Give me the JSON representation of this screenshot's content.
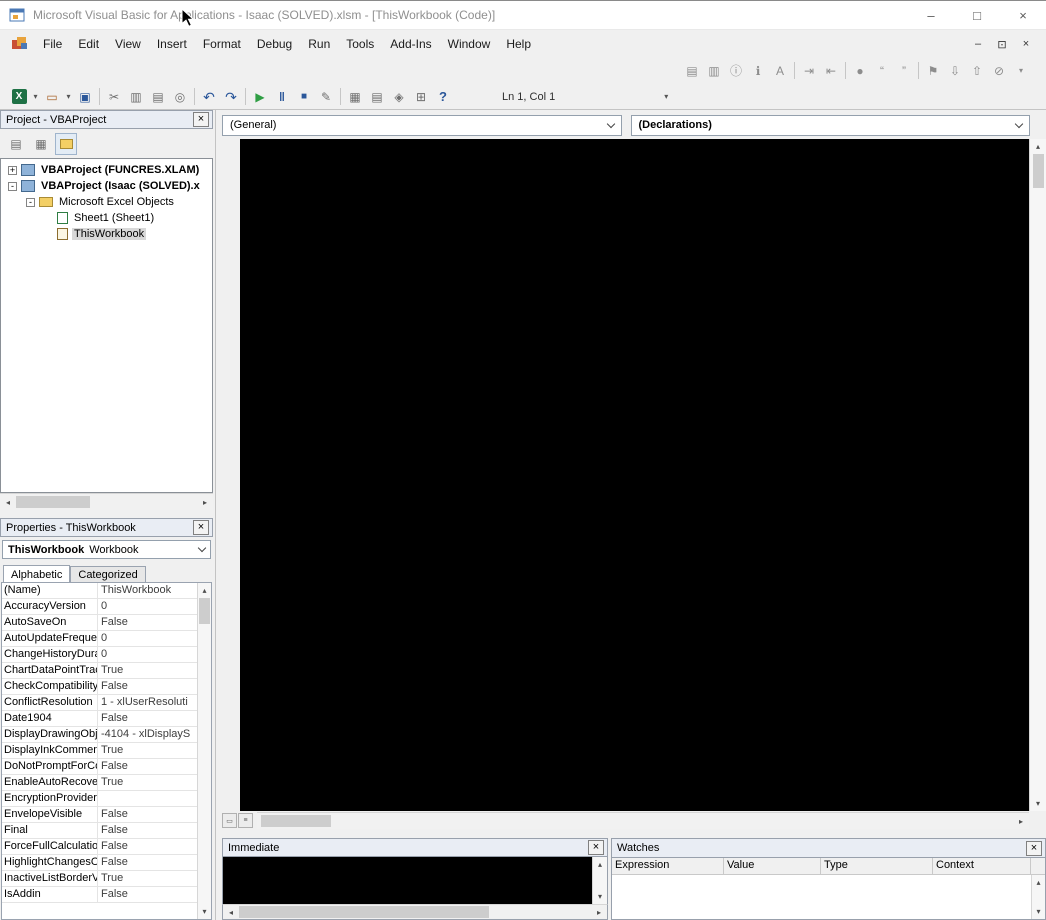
{
  "window": {
    "title": "Microsoft Visual Basic for Applications - Isaac (SOLVED).xlsm - [ThisWorkbook (Code)]",
    "controls": {
      "minimize": "–",
      "maximize": "□",
      "close": "×"
    },
    "mdi": {
      "minimize": "–",
      "restore": "⊡",
      "close": "×"
    }
  },
  "menu": {
    "items": [
      "File",
      "Edit",
      "View",
      "Insert",
      "Format",
      "Debug",
      "Run",
      "Tools",
      "Add-Ins",
      "Window",
      "Help"
    ]
  },
  "toolbars": {
    "position_indicator": "Ln 1, Col 1",
    "overflow_glyph": "▾",
    "standard": {
      "g1": [
        {
          "name": "view-excel-button",
          "glyph": "X"
        },
        {
          "name": "view-excel-dropdown-arrow",
          "glyph": "▾"
        },
        {
          "name": "insert-userform-button",
          "glyph": "▭"
        },
        {
          "name": "insert-userform-dropdown-arrow",
          "glyph": "▾"
        },
        {
          "name": "save-button",
          "glyph": "▣"
        }
      ],
      "g2": [
        {
          "name": "cut-button",
          "glyph": "✂"
        },
        {
          "name": "copy-button",
          "glyph": "▥"
        },
        {
          "name": "paste-button",
          "glyph": "▤"
        },
        {
          "name": "find-button",
          "glyph": "◎"
        }
      ],
      "g3": [
        {
          "name": "undo-button",
          "glyph": "↶"
        },
        {
          "name": "redo-button",
          "glyph": "↷"
        }
      ],
      "g4": [
        {
          "name": "run-button",
          "glyph": "▶"
        },
        {
          "name": "break-button",
          "glyph": "‖"
        },
        {
          "name": "reset-button",
          "glyph": "■"
        },
        {
          "name": "design-mode-button",
          "glyph": "✎"
        }
      ],
      "g5": [
        {
          "name": "project-explorer-button",
          "glyph": "▦"
        },
        {
          "name": "properties-window-button",
          "glyph": "▤"
        },
        {
          "name": "object-browser-button",
          "glyph": "◈"
        },
        {
          "name": "toolbox-button",
          "glyph": "⊞"
        },
        {
          "name": "help-button",
          "glyph": "?"
        }
      ]
    },
    "edit": {
      "g1": [
        {
          "name": "list-properties-button",
          "glyph": "▤"
        },
        {
          "name": "list-constants-button",
          "glyph": "▥"
        },
        {
          "name": "quick-info-button",
          "glyph": "ⓘ"
        },
        {
          "name": "parameter-info-button",
          "glyph": "ℹ"
        },
        {
          "name": "complete-word-button",
          "glyph": "A"
        }
      ],
      "g2": [
        {
          "name": "indent-button",
          "glyph": "⇥"
        },
        {
          "name": "outdent-button",
          "glyph": "⇤"
        }
      ],
      "g3": [
        {
          "name": "toggle-breakpoint-button",
          "glyph": "●"
        },
        {
          "name": "comment-block-button",
          "glyph": "“"
        },
        {
          "name": "uncomment-block-button",
          "glyph": "”"
        }
      ],
      "g4": [
        {
          "name": "toggle-bookmark-button",
          "glyph": "⚑"
        },
        {
          "name": "next-bookmark-button",
          "glyph": "⇩"
        },
        {
          "name": "previous-bookmark-button",
          "glyph": "⇧"
        },
        {
          "name": "clear-bookmarks-button",
          "glyph": "⊘"
        }
      ]
    }
  },
  "project": {
    "title": "Project - VBAProject",
    "tools": [
      {
        "name": "view-code-button",
        "glyph": "▤"
      },
      {
        "name": "view-object-button",
        "glyph": "▦"
      },
      {
        "name": "toggle-folders-button",
        "glyph": ""
      }
    ],
    "tree": [
      {
        "label": "VBAProject (FUNCRES.XLAM)",
        "expander": "+"
      },
      {
        "label": "VBAProject (Isaac (SOLVED).x",
        "expander": "-"
      },
      {
        "label": "Microsoft Excel Objects",
        "expander": "-"
      },
      {
        "label": "Sheet1 (Sheet1)"
      },
      {
        "label": "ThisWorkbook"
      }
    ]
  },
  "properties": {
    "title": "Properties - ThisWorkbook",
    "object_name": "ThisWorkbook",
    "object_type": "Workbook",
    "tabs": [
      "Alphabetic",
      "Categorized"
    ],
    "rows": [
      {
        "name": "(Name)",
        "value": "ThisWorkbook"
      },
      {
        "name": "AccuracyVersion",
        "value": "0"
      },
      {
        "name": "AutoSaveOn",
        "value": "False"
      },
      {
        "name": "AutoUpdateFreque",
        "value": "0"
      },
      {
        "name": "ChangeHistoryDura",
        "value": "0"
      },
      {
        "name": "ChartDataPointTrac",
        "value": "True"
      },
      {
        "name": "CheckCompatibility",
        "value": "False"
      },
      {
        "name": "ConflictResolution",
        "value": "1 - xlUserResoluti"
      },
      {
        "name": "Date1904",
        "value": "False"
      },
      {
        "name": "DisplayDrawingObje",
        "value": "-4104 - xlDisplayS"
      },
      {
        "name": "DisplayInkComment",
        "value": "True"
      },
      {
        "name": "DoNotPromptForCo",
        "value": "False"
      },
      {
        "name": "EnableAutoRecove",
        "value": "True"
      },
      {
        "name": "EncryptionProvider",
        "value": ""
      },
      {
        "name": "EnvelopeVisible",
        "value": "False"
      },
      {
        "name": "Final",
        "value": "False"
      },
      {
        "name": "ForceFullCalculation",
        "value": "False"
      },
      {
        "name": "HighlightChangesO",
        "value": "False"
      },
      {
        "name": "InactiveListBorderV",
        "value": "True"
      },
      {
        "name": "IsAddin",
        "value": "False"
      }
    ]
  },
  "code": {
    "left_combo": "(General)",
    "right_combo": "(Declarations)"
  },
  "immediate": {
    "title": "Immediate"
  },
  "watches": {
    "title": "Watches",
    "columns": [
      "Expression",
      "Value",
      "Type",
      "Context"
    ]
  },
  "ui": {
    "close_glyph": "×",
    "arrows": {
      "up": "▴",
      "down": "▾",
      "left": "◂",
      "right": "▸"
    }
  }
}
